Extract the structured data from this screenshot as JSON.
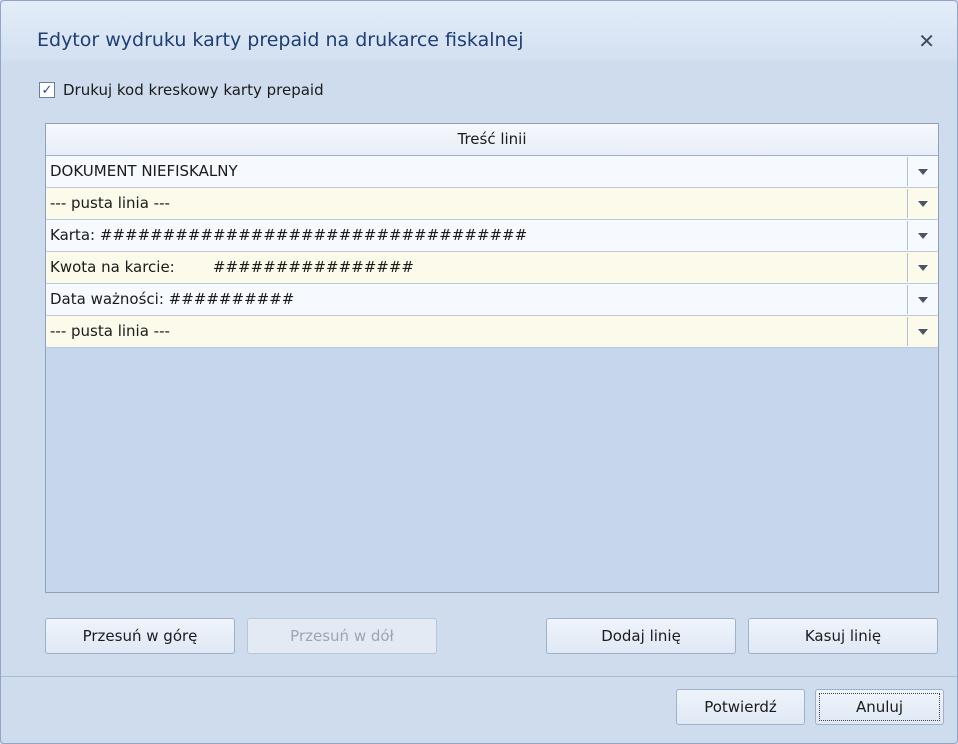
{
  "window": {
    "title": "Edytor wydruku karty prepaid na drukarce fiskalnej",
    "close_glyph": "✕"
  },
  "checkbox": {
    "checked": true,
    "label": "Drukuj kod kreskowy karty prepaid"
  },
  "grid": {
    "header": "Treść linii",
    "rows": [
      {
        "text": "DOKUMENT NIEFISKALNY"
      },
      {
        "text": "--- pusta linia ---"
      },
      {
        "text": "Karta: ##################################"
      },
      {
        "text": "Kwota na karcie:        ################"
      },
      {
        "text": "Data ważności: ##########"
      },
      {
        "text": "--- pusta linia ---"
      }
    ]
  },
  "buttons": {
    "move_up": "Przesuń w górę",
    "move_down": "Przesuń w dół",
    "add_line": "Dodaj linię",
    "delete_line": "Kasuj linię",
    "confirm": "Potwierdź",
    "cancel": "Anuluj"
  },
  "icons": {
    "checkbox": "checkmark-icon",
    "close": "close-icon",
    "dropdown": "chevron-down-icon"
  },
  "colors": {
    "title_text": "#1e3f72",
    "row_odd": "#f6f9fe",
    "row_even": "#fcfbeb"
  }
}
